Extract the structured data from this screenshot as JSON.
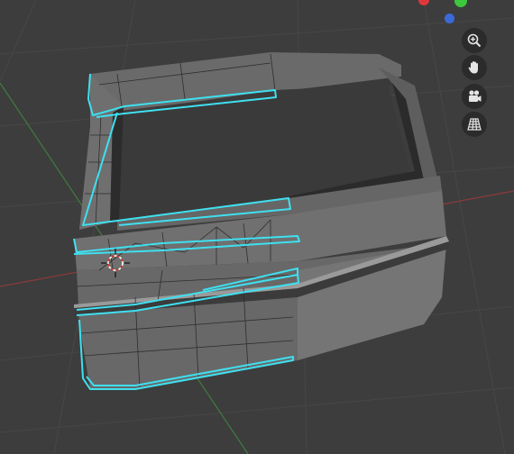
{
  "viewport": {
    "name": "3D Viewport",
    "background": "#3d3d3d",
    "grid_line_color": "#4a4a4a",
    "x_axis_color": "#a23a3a",
    "y_axis_color": "#3e8a3e"
  },
  "model": {
    "name": "tailgate-mesh",
    "base_color": "#6b6b6b",
    "dark_color": "#2a2a2a",
    "light_color": "#8a8a8a",
    "wire_color": "#222222",
    "selected_edge_color": "#3fe0f0"
  },
  "cursor": {
    "name": "3d-cursor",
    "ring_color_a": "#d23a2a",
    "ring_color_b": "#ffffff"
  },
  "gizmo": {
    "x_color": "#e0383a",
    "y_color": "#3cc83c",
    "z_color": "#3a6ad8"
  },
  "nav_buttons": [
    {
      "id": "zoom",
      "icon": "zoom-in-icon"
    },
    {
      "id": "pan",
      "icon": "hand-pan-icon"
    },
    {
      "id": "camera",
      "icon": "camera-view-icon"
    },
    {
      "id": "ortho",
      "icon": "perspective-grid-icon"
    }
  ]
}
